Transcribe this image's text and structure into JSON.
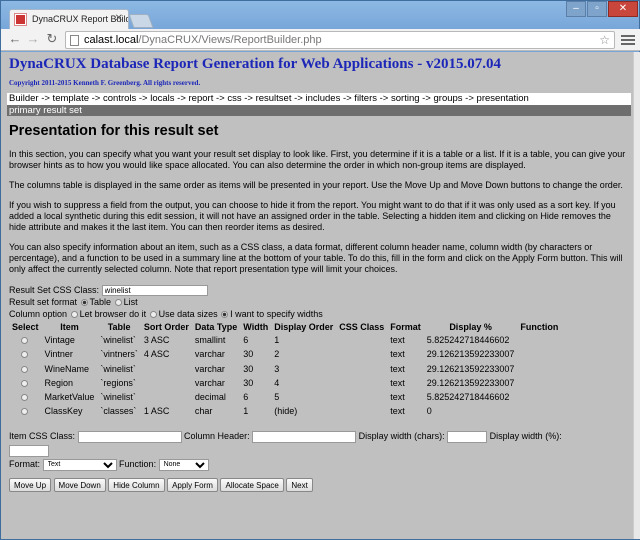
{
  "browser": {
    "tab_title": "DynaCRUX Report Builder",
    "url_host": "calast.local",
    "url_path": "/DynaCRUX/Views/ReportBuilder.php"
  },
  "app": {
    "title": "DynaCRUX Database Report Generation for Web Applications - v2015.07.04",
    "copyright": "Copyright 2011-2015 Kenneth F. Greenberg. All rights reserved.",
    "breadcrumb": "Builder -> template -> controls -> locals -> report -> css -> resultset -> includes -> filters -> sorting -> groups -> presentation",
    "subbar": "primary result set"
  },
  "section": {
    "heading": "Presentation for this result set",
    "paragraphs": [
      "In this section, you can specify what you want your result set display to look like. First, you determine if it is a table or a list. If it is a table, you can give your browser hints as to how you would like space allocated. You can also determine the order in which non-group items are displayed.",
      "The columns table is displayed in the same order as items will be presented in your report. Use the Move Up and Move Down buttons to change the order.",
      "If you wish to suppress a field from the output, you can choose to hide it from the report. You might want to do that if it was only used as a sort key. If you added a local synthetic during this edit session, it will not have an assigned order in the table. Selecting a hidden item and clicking on Hide removes the hide attribute and makes it the last item. You can then reorder items as desired.",
      "You can also specify information about an item, such as a CSS class, a data format, different column header name, column width (by characters or percentage), and a function to be used in a summary line at the bottom of your table. To do this, fill in the form and click on the Apply Form button. This will only affect the currently selected column. Note that report presentation type will limit your choices."
    ]
  },
  "resultset_form": {
    "css_label": "Result Set CSS Class:",
    "css_value": "winelist",
    "format_label": "Result set format",
    "format_options": [
      "Table",
      "List"
    ],
    "format_selected": "Table",
    "column_label": "Column option",
    "column_options": [
      "Let browser do it",
      "Use data sizes",
      "I want to specify widths"
    ],
    "column_selected": "I want to specify widths"
  },
  "items_table": {
    "headers": [
      "Select",
      "Item",
      "Table",
      "Sort Order",
      "Data Type",
      "Width",
      "Display Order",
      "CSS Class",
      "Format",
      "Display %",
      "Function"
    ],
    "rows": [
      {
        "item": "Vintage",
        "table": "`winelist`",
        "sort": "3 ASC",
        "type": "smallint",
        "width": "6",
        "order": "1",
        "css": "",
        "format": "text",
        "pct": "5.825242718446602",
        "func": ""
      },
      {
        "item": "Vintner",
        "table": "`vintners`",
        "sort": "4 ASC",
        "type": "varchar",
        "width": "30",
        "order": "2",
        "css": "",
        "format": "text",
        "pct": "29.126213592233007",
        "func": ""
      },
      {
        "item": "WineName",
        "table": "`winelist`",
        "sort": "",
        "type": "varchar",
        "width": "30",
        "order": "3",
        "css": "",
        "format": "text",
        "pct": "29.126213592233007",
        "func": ""
      },
      {
        "item": "Region",
        "table": "`regions`",
        "sort": "",
        "type": "varchar",
        "width": "30",
        "order": "4",
        "css": "",
        "format": "text",
        "pct": "29.126213592233007",
        "func": ""
      },
      {
        "item": "MarketValue",
        "table": "`winelist`",
        "sort": "",
        "type": "decimal",
        "width": "6",
        "order": "5",
        "css": "",
        "format": "text",
        "pct": "5.825242718446602",
        "func": ""
      },
      {
        "item": "ClassKey",
        "table": "`classes`",
        "sort": "1 ASC",
        "type": "char",
        "width": "1",
        "order": "(hide)",
        "css": "",
        "format": "text",
        "pct": "0",
        "func": ""
      }
    ]
  },
  "item_form": {
    "css_label": "Item CSS Class:",
    "header_label": "Column Header:",
    "width_chars_label": "Display width (chars):",
    "width_pct_label": "Display width (%):",
    "format_label": "Format:",
    "format_value": "Text",
    "function_label": "Function:",
    "function_value": "None"
  },
  "buttons": {
    "move_up": "Move Up",
    "move_down": "Move Down",
    "hide_column": "Hide Column",
    "apply_form": "Apply Form",
    "allocate_space": "Allocate Space",
    "next": "Next"
  }
}
